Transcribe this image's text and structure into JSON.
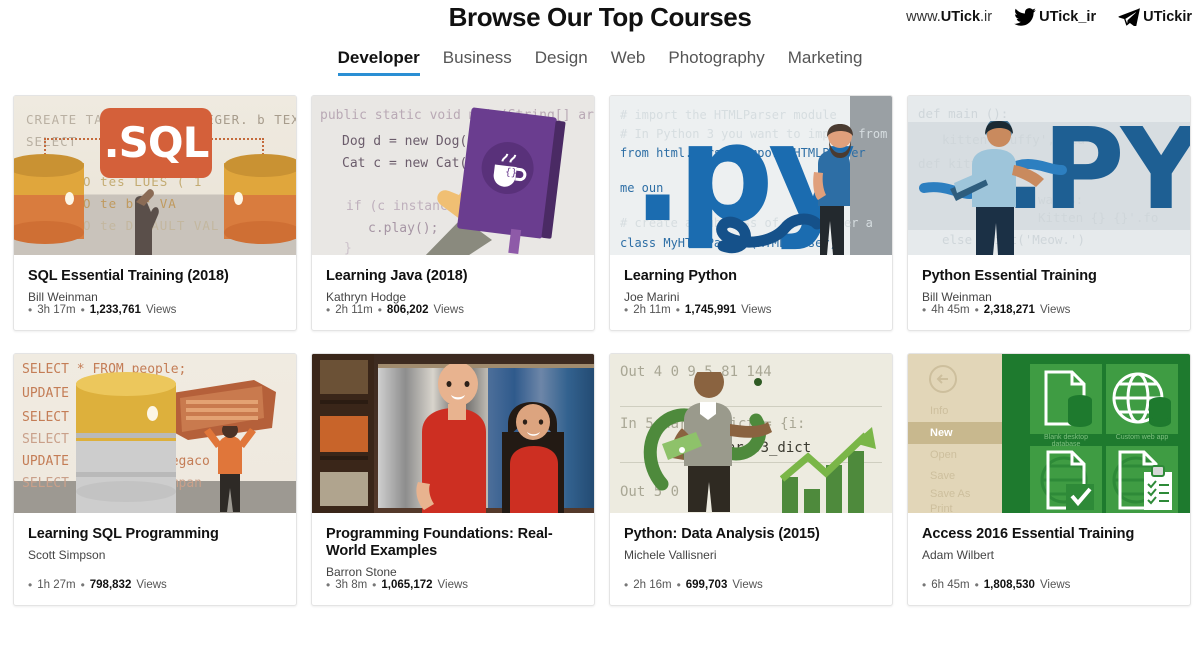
{
  "header": {
    "title": "Browse Our Top Courses",
    "brand": [
      {
        "icon": "none",
        "prefix": "www.",
        "name": "UTick",
        "suffix": ".ir"
      },
      {
        "icon": "twitter-icon",
        "name": "UTick_ir"
      },
      {
        "icon": "telegram-icon",
        "name": "UTickir"
      }
    ]
  },
  "tabs": [
    {
      "label": "Developer",
      "active": true
    },
    {
      "label": "Business",
      "active": false
    },
    {
      "label": "Design",
      "active": false
    },
    {
      "label": "Web",
      "active": false
    },
    {
      "label": "Photography",
      "active": false
    },
    {
      "label": "Marketing",
      "active": false
    }
  ],
  "meta_labels": {
    "bullet": "•",
    "views": "Views"
  },
  "colors": {
    "accent": "#2a8fd4",
    "tab_active_text": "#111111",
    "tab_text": "#555555",
    "card_border": "#e4e4e4",
    "page_bg": "#ffffff"
  },
  "courses": [
    {
      "title": "SQL Essential Training (2018)",
      "author": "Bill Weinman",
      "duration": "3h 17m",
      "views": "1,233,761",
      "thumb": {
        "name": "sql-essential-training-thumbnail",
        "code_lines": [
          "CREATE TABLE",
          "EGER. b TEXT",
          "SELECT",
          "NTO tes LUES ( 1",
          "NTO te b c  VA",
          "NTO te DEFAULT VAL"
        ]
      }
    },
    {
      "title": "Learning Java (2018)",
      "author": "Kathryn Hodge",
      "duration": "2h 11m",
      "views": "806,202",
      "thumb": {
        "name": "learning-java-thumbnail",
        "code_lines": [
          "public static void main(String[] args",
          "Dog d = new Dog();",
          "Cat c = new Cat();",
          "if (c instanceof",
          "c.play();",
          "}"
        ]
      }
    },
    {
      "title": "Learning Python",
      "author": "Joe Marini",
      "duration": "2h 11m",
      "views": "1,745,991",
      "thumb": {
        "name": "learning-python-thumbnail",
        "big_text": ".py",
        "code_lines": [
          "# import the HTMLParser module",
          "# In Python 3 you want to import from",
          "from html.parser import HTMLParser",
          "me  oun",
          "# create a subclass of HTMLParser a",
          "class MyHTMLParser(HTMLParser):"
        ]
      }
    },
    {
      "title": "Python Essential Training",
      "author": "Bill Weinman",
      "duration": "4h 45m",
      "views": "2,318,271",
      "thumb": {
        "name": "python-essential-training-thumbnail",
        "big_text": ".PY",
        "code_lines": [
          "def main ():",
          "kitten('Buffy', 'la rr'",
          "def kitten(*args",
          "wargs:",
          "Kitten {}  {}'.fo",
          "else print('Meow.')"
        ]
      }
    },
    {
      "title": "Learning SQL Programming",
      "author": "Scott Simpson",
      "duration": "1h 27m",
      "views": "798,832",
      "thumb": {
        "name": "learning-sql-programming-thumbnail",
        "code_lines": [
          "SELECT * FROM people;",
          "UPDATE p                 = 'Mar",
          "SELECT *",
          "SELECT *                 compan",
          "UPDATE p        company 'Megaco",
          "SELECT *        e WHERE compan"
        ]
      }
    },
    {
      "title": "Programming Foundations: Real-World Examples",
      "author": "Barron Stone",
      "duration": "3h 8m",
      "views": "1,065,172",
      "thumb": {
        "name": "programming-foundations-thumbnail",
        "photo": "closet-with-two-presenters"
      }
    },
    {
      "title": "Python: Data Analysis (2015)",
      "author": "Michele Vallisneri",
      "duration": "2h 16m",
      "views": "699,703",
      "thumb": {
        "name": "python-data-analysis-thumbnail",
        "code_lines": [
          "Out  4      0  9 5  81  144",
          "In   5      uares3_dict = {i:",
          "quares3_dict",
          "Out  5      0  0"
        ]
      }
    },
    {
      "title": "Access 2016 Essential Training",
      "author": "Adam Wilbert",
      "duration": "6h 45m",
      "views": "1,808,530",
      "thumb": {
        "name": "access-2016-essential-training-thumbnail",
        "sidebar_items": [
          "Info",
          "New",
          "Open",
          "Save",
          "Save As",
          "Print"
        ],
        "active_sidebar_item": "New",
        "tiles": [
          "Blank desktop database",
          "Custom web app",
          "",
          ""
        ]
      }
    }
  ]
}
